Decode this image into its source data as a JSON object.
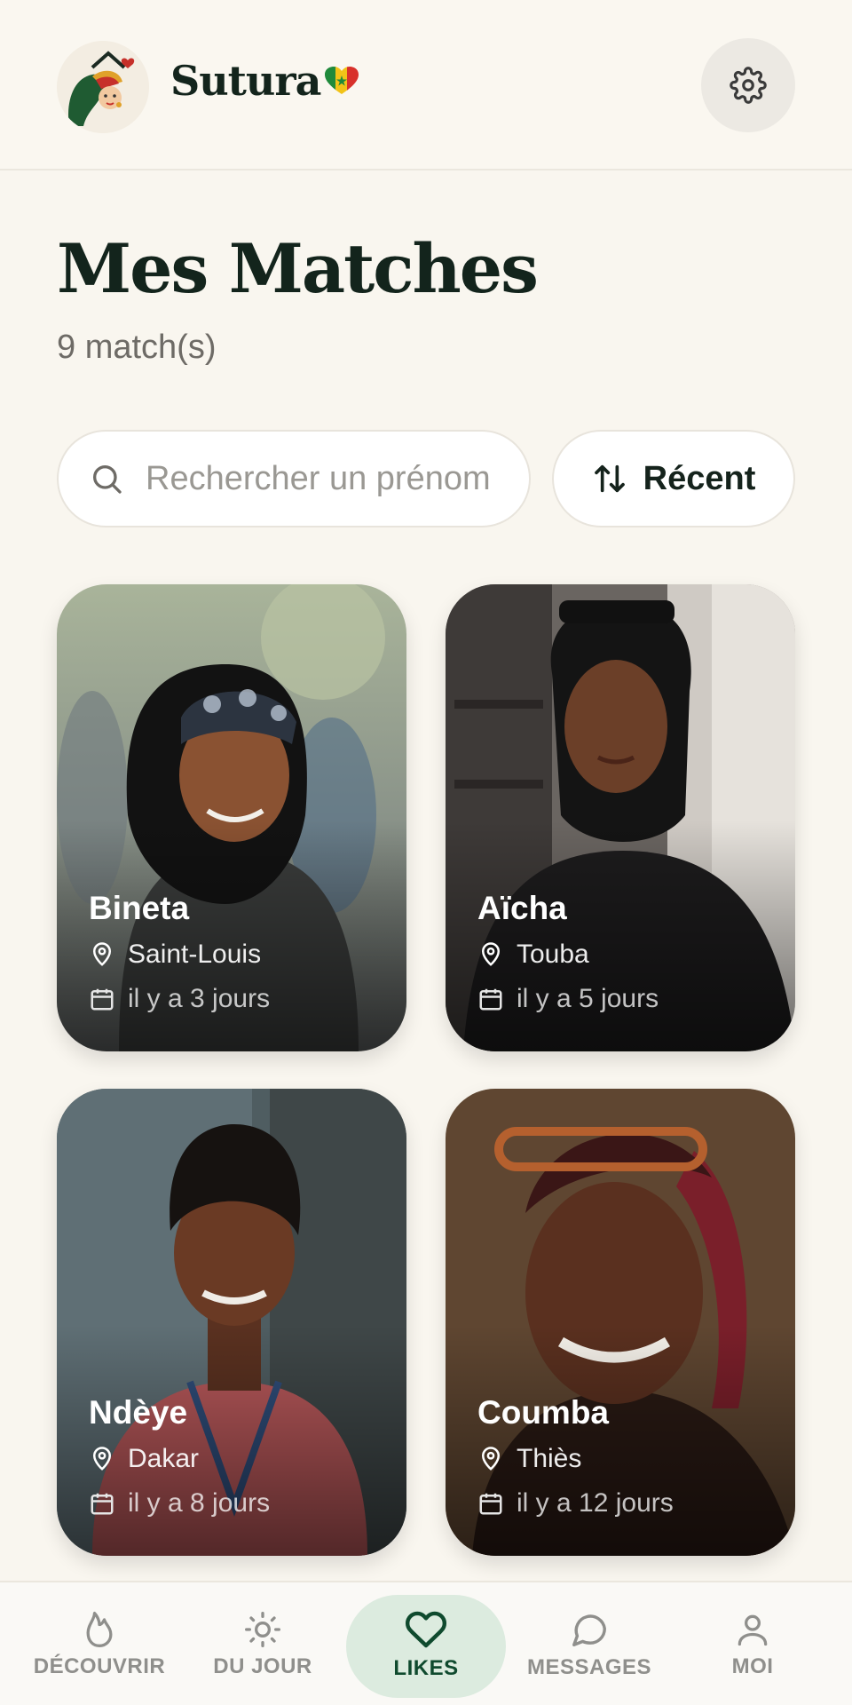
{
  "header": {
    "brand": "Sutura",
    "logo_icon": "woman-house-logo-icon",
    "flag_heart_icon": "senegal-flag-heart-icon",
    "settings_icon": "gear-icon"
  },
  "page": {
    "title": "Mes Matches",
    "count": "9 match(s)"
  },
  "search": {
    "placeholder": "Rechercher un prénom",
    "value": ""
  },
  "sort": {
    "label": "Récent",
    "icon": "sort-arrows-icon"
  },
  "matches": [
    {
      "name": "Bineta",
      "city": "Saint-Louis",
      "since": "il y a 3 jours"
    },
    {
      "name": "Aïcha",
      "city": "Touba",
      "since": "il y a 5 jours"
    },
    {
      "name": "Ndèye",
      "city": "Dakar",
      "since": "il y a 8 jours"
    },
    {
      "name": "Coumba",
      "city": "Thiès",
      "since": "il y a 12 jours"
    }
  ],
  "nav": [
    {
      "label": "DÉCOUVRIR",
      "icon": "flame-icon"
    },
    {
      "label": "DU JOUR",
      "icon": "sun-icon"
    },
    {
      "label": "LIKES",
      "icon": "heart-icon",
      "active": true
    },
    {
      "label": "MESSAGES",
      "icon": "chat-bubble-icon"
    },
    {
      "label": "MOI",
      "icon": "user-icon"
    }
  ],
  "colors": {
    "background": "#f9f6ef",
    "primary_dark": "#13241c",
    "accent_green": "#0f4a2e",
    "active_pill": "#dcebdf"
  }
}
